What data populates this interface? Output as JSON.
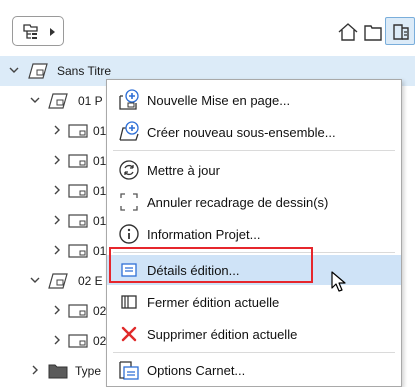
{
  "toolbar": {
    "view_icons": [
      "house-view-icon",
      "layout-book-icon",
      "publisher-sets-icon"
    ]
  },
  "tree": {
    "root_label": "Sans Titre",
    "items": [
      {
        "label": "01 P",
        "kind": "subset",
        "expanded": true
      },
      {
        "label": "01",
        "kind": "layout"
      },
      {
        "label": "01",
        "kind": "layout"
      },
      {
        "label": "01",
        "kind": "layout"
      },
      {
        "label": "01",
        "kind": "layout"
      },
      {
        "label": "01",
        "kind": "layout"
      },
      {
        "label": "02 E",
        "kind": "subset",
        "expanded": true
      },
      {
        "label": "02",
        "kind": "layout"
      },
      {
        "label": "02",
        "kind": "layout"
      },
      {
        "label": "Type",
        "kind": "folder"
      }
    ]
  },
  "menu": {
    "items": [
      {
        "label": "Nouvelle Mise en page...",
        "icon": "new-layout-icon"
      },
      {
        "label": "Créer nouveau sous-ensemble...",
        "icon": "new-subset-icon"
      },
      {
        "label": "Mettre à jour",
        "icon": "update-icon"
      },
      {
        "label": "Annuler recadrage de dessin(s)",
        "icon": "crop-icon"
      },
      {
        "label": "Information Projet...",
        "icon": "info-icon"
      },
      {
        "label": "Détails édition...",
        "icon": "edition-details-icon",
        "highlighted": true
      },
      {
        "label": "Fermer édition actuelle",
        "icon": "close-edition-icon"
      },
      {
        "label": "Supprimer édition actuelle",
        "icon": "delete-icon"
      },
      {
        "label": "Options Carnet...",
        "icon": "book-options-icon"
      }
    ]
  },
  "colors": {
    "selection": "#dcebf8",
    "menu_highlight": "#cfe3f7",
    "focus_outline": "#e6262c",
    "icon_blue": "#2e6fd6",
    "delete_red": "#e02a2a"
  }
}
